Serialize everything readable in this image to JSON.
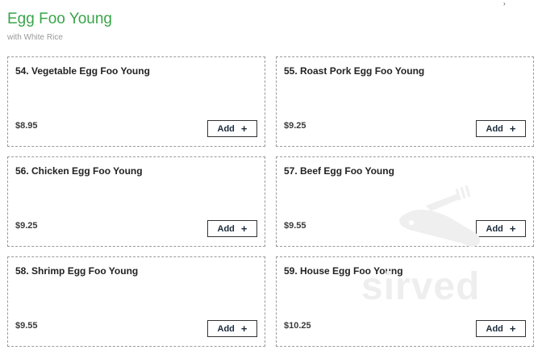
{
  "section": {
    "title": "Egg Foo Young",
    "subtitle": "with White Rice"
  },
  "items": [
    {
      "name": "54. Vegetable Egg Foo Young",
      "price": "$8.95",
      "add_label": "Add"
    },
    {
      "name": "55. Roast Pork Egg Foo Young",
      "price": "$9.25",
      "add_label": "Add"
    },
    {
      "name": "56. Chicken Egg Foo Young",
      "price": "$9.25",
      "add_label": "Add"
    },
    {
      "name": "57. Beef Egg Foo Young",
      "price": "$9.55",
      "add_label": "Add"
    },
    {
      "name": "58. Shrimp Egg Foo Young",
      "price": "$9.55",
      "add_label": "Add"
    },
    {
      "name": "59. House Egg Foo Young",
      "price": "$10.25",
      "add_label": "Add"
    }
  ],
  "watermark": {
    "text": "sirved",
    "icon": "fork-knife-icon"
  },
  "icons": {
    "add": "plus-icon"
  },
  "colors": {
    "title": "#3aa54a",
    "border": "#9a9a9a",
    "button_text": "#1b2a3a"
  }
}
